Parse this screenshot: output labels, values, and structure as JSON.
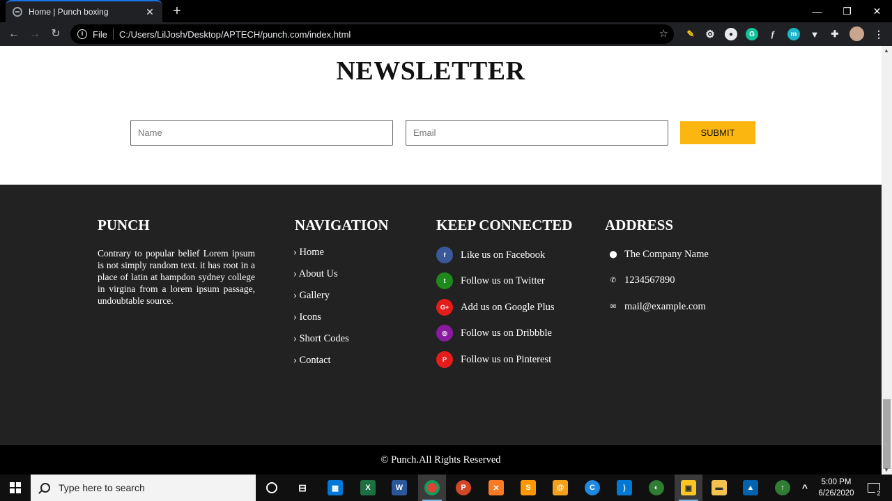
{
  "browser": {
    "tab_title": "Home | Punch boxing",
    "new_tab": "+",
    "file_label": "File",
    "url": "C:/Users/LilJosh/Desktop/APTECH/punch.com/index.html"
  },
  "newsletter": {
    "title": "NEWSLETTER",
    "name_placeholder": "Name",
    "email_placeholder": "Email",
    "submit_label": "SUBMIT"
  },
  "footer": {
    "brand": {
      "heading": "PUNCH",
      "text": "Contrary to popular belief Lorem ipsum is not simply random text. it has root in a place of latin at hampdon sydney college in virgina from a lorem ipsum passage, undoubtable source."
    },
    "navigation": {
      "heading": "NAVIGATION",
      "links": [
        "Home",
        "About Us",
        "Gallery",
        "Icons",
        "Short Codes",
        "Contact"
      ]
    },
    "connected": {
      "heading": "KEEP CONNECTED",
      "items": [
        {
          "label": "Like us on Facebook",
          "icon": "facebook-icon",
          "glyph": "f",
          "color": "#3b5998"
        },
        {
          "label": "Follow us on Twitter",
          "icon": "twitter-icon",
          "glyph": "t",
          "color": "#1e8a1e"
        },
        {
          "label": "Add us on Google Plus",
          "icon": "google-plus-icon",
          "glyph": "G+",
          "color": "#e51c1c"
        },
        {
          "label": "Follow us on Dribbble",
          "icon": "dribbble-icon",
          "glyph": "◎",
          "color": "#8a1aa0"
        },
        {
          "label": "Follow us on Pinterest",
          "icon": "pinterest-icon",
          "glyph": "P",
          "color": "#e51c1c"
        }
      ]
    },
    "address": {
      "heading": "ADDRESS",
      "company": "The Company Name",
      "phone": "1234567890",
      "email": "mail@example.com"
    },
    "copyright": "© Punch.All Rights Reserved"
  },
  "colors": {
    "accent": "#fbb710",
    "footer_bg": "#222222",
    "copyright_bg": "#000000"
  },
  "taskbar": {
    "search_placeholder": "Type here to search",
    "time": "5:00 PM",
    "date": "6/26/2020",
    "notification_count": "2"
  }
}
